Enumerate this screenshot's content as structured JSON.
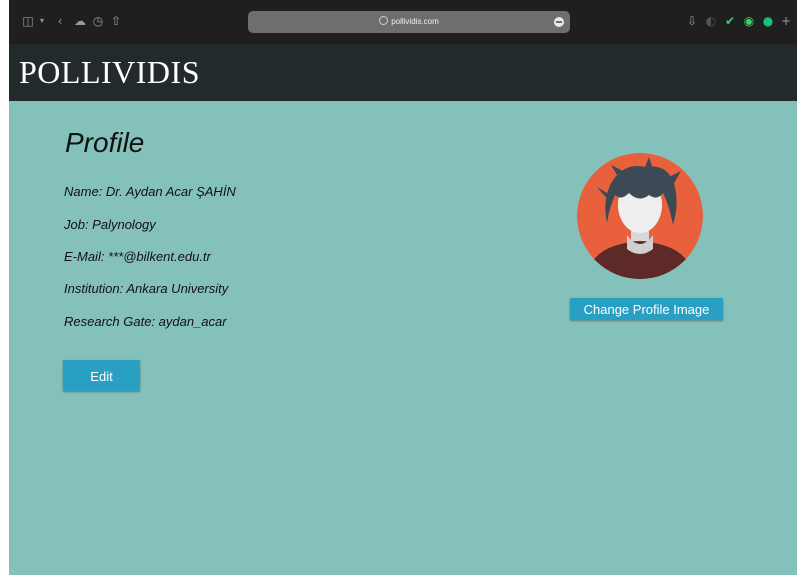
{
  "browser": {
    "url": "pollividis.com"
  },
  "site": {
    "logo": "POLLIVIDIS"
  },
  "profile": {
    "title": "Profile",
    "name": "Name: Dr. Aydan Acar ŞAHİN",
    "job": "Job: Palynology",
    "email": "E-Mail: ***@bilkent.edu.tr",
    "institution": "Institution: Ankara University",
    "research_gate": "Research Gate: aydan_acar",
    "edit_label": "Edit",
    "change_image_label": "Change Profile Image"
  },
  "colors": {
    "page_background": "#85c1bb",
    "header_background": "#232a2b",
    "button": "#2a9fc4",
    "avatar_background": "#e8603c"
  }
}
